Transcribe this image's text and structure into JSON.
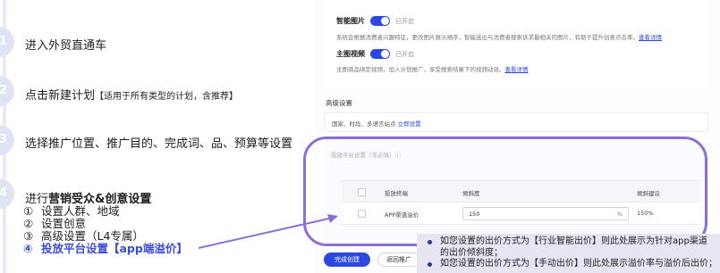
{
  "steps": [
    {
      "num": "1",
      "title": "进入外贸直通车",
      "note": ""
    },
    {
      "num": "2",
      "title": "点击新建计划",
      "note": "【适用于所有类型的计划，含推荐】"
    },
    {
      "num": "3",
      "title": "选择推广位置、推广目的、完成词、品、预算等设置",
      "note": ""
    },
    {
      "num": "4",
      "title_prefix": "进行",
      "title_bold": "营销受众&创意设置",
      "note": ""
    }
  ],
  "sub_items": [
    {
      "num": "①",
      "label": "设置人群、地域"
    },
    {
      "num": "②",
      "label": "设置创意"
    },
    {
      "num": "③",
      "label": "高级设置（L4专属）"
    },
    {
      "num": "④",
      "label": "投放平台设置【app端溢价】"
    }
  ],
  "form": {
    "smart_image": {
      "label": "智能图片",
      "state": "已开启",
      "desc": "系统会根据消费者兴趣特征，更改图片展示顺序，智能选出与消费者搜索诉求最相关的图片，有助于提升创意点击率。",
      "link": "查看详情"
    },
    "main_video": {
      "label": "主图视频",
      "state": "已开启",
      "desc": "主图商品绑定视频，加入计划推广，享受搜索结果下的视频动效。",
      "link": "查看详情"
    },
    "advanced": {
      "title": "高级设置",
      "desc": "国家、时段、多语言站点",
      "link": "立即设置"
    },
    "platform": {
      "title": "投放平台设置（非必填）ⓘ",
      "columns": [
        "投放终端",
        "倾斜度",
        "倾斜建议"
      ],
      "rows": [
        {
          "terminal": "APP渠道溢价",
          "rate": "150",
          "unit": "%",
          "suggest": "150%"
        }
      ]
    },
    "buttons": {
      "create": "完成创建",
      "back": "返回推广"
    }
  },
  "note": [
    "如您设置的出价方式为【行业智能出价】则此处展示为针对app渠道",
    "的出价倾斜度；",
    "如您设置的出价方式为【手动出价】则此处展示溢价率与溢价后出价；"
  ],
  "colors": {
    "accent": "#2b48e0",
    "highlight": "#8b6fd6",
    "step_accent": "#3c4bdc",
    "note_bg": "#e5e6f2"
  }
}
